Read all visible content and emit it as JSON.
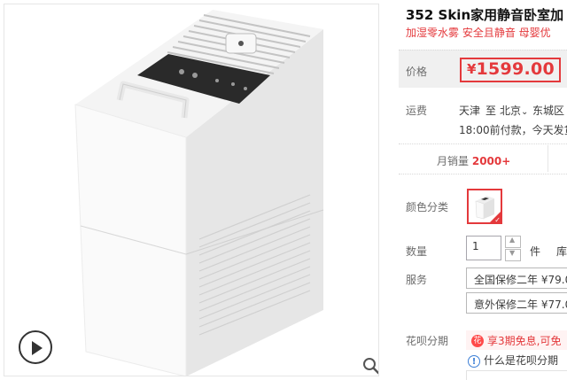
{
  "product": {
    "title": "352 Skin家用静音卧室加",
    "subtitle": "加湿零水雾 安全且静音 母婴优"
  },
  "price": {
    "label": "价格",
    "currency": "¥",
    "amount": "1599.00"
  },
  "shipping": {
    "label": "运费",
    "from": "天津",
    "to_word": "至",
    "city": "北京",
    "district": "东城区",
    "chevron": "⌄",
    "note": "18:00前付款，今天发货"
  },
  "sales": {
    "label": "月销量",
    "value": "2000+"
  },
  "color": {
    "label": "颜色分类",
    "selected_icon": "check-mark"
  },
  "quantity": {
    "label": "数量",
    "value": "1",
    "unit": "件",
    "stock_label": "库"
  },
  "services": {
    "label": "服务",
    "options": [
      {
        "name": "全国保修二年",
        "price": "¥79.0"
      },
      {
        "name": "意外保修二年",
        "price": "¥77.0"
      }
    ]
  },
  "huabei": {
    "label": "花呗分期",
    "promo": "享3期免息,可免",
    "help": "什么是花呗分期"
  },
  "gallery": {
    "play_icon": "play-icon",
    "zoom_icon": "zoom-icon"
  },
  "colors": {
    "accent": "#e4393c",
    "price_bg": "#f0f0f0"
  }
}
